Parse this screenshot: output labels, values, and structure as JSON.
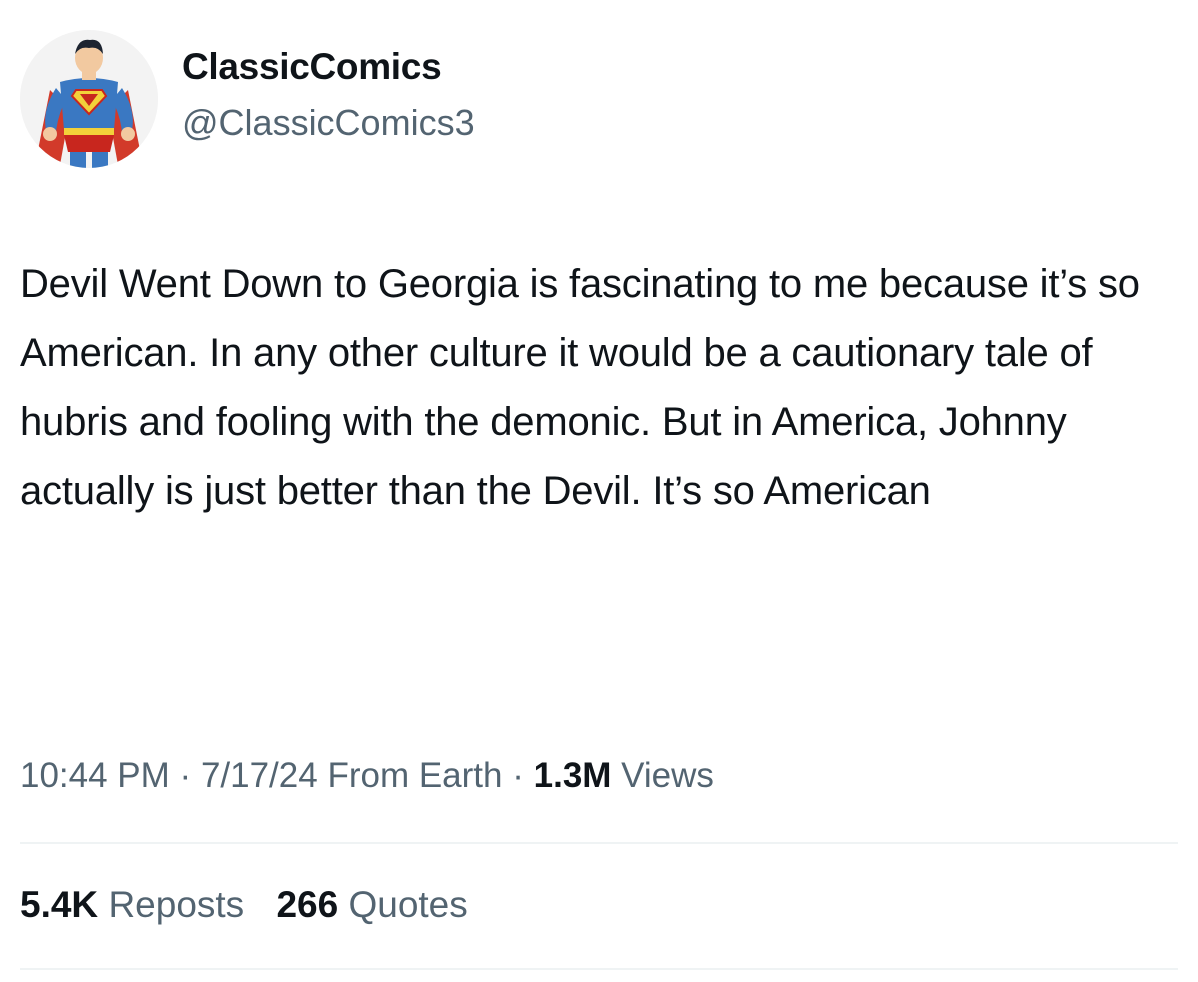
{
  "author": {
    "display_name": "ClassicComics",
    "handle": "@ClassicComics3",
    "avatar_icon": "superman-avatar-icon"
  },
  "tweet": {
    "text": "Devil Went Down to Georgia is fascinating to me because it’s so American. In any other culture it would be a cautionary tale of hubris and fooling with the demonic. But in America, Johnny actually is just better than the Devil. It’s so American"
  },
  "meta": {
    "time": "10:44 PM",
    "separator": "·",
    "date": "7/17/24",
    "source": "From Earth",
    "views_count": "1.3M",
    "views_label": "Views"
  },
  "stats": {
    "reposts_count": "5.4K",
    "reposts_label": "Reposts",
    "quotes_count": "266",
    "quotes_label": "Quotes"
  },
  "colors": {
    "text": "#0f1419",
    "secondary_text": "#536471",
    "divider": "#eff3f4"
  }
}
